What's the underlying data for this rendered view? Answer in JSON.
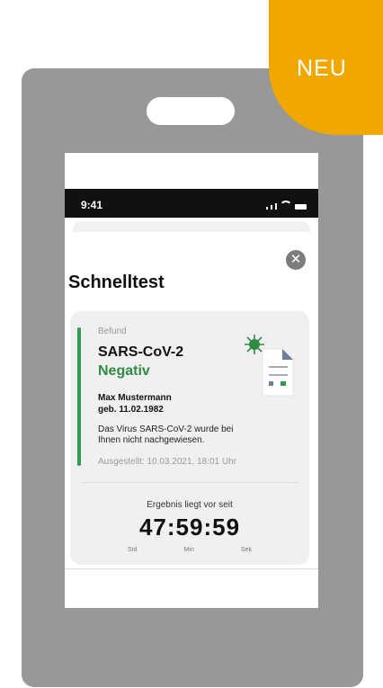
{
  "badge": {
    "label": "NEU",
    "color": "#f0a800"
  },
  "status_bar": {
    "time": "9:41"
  },
  "sheet": {
    "title": "Schnelltest"
  },
  "result": {
    "label": "Befund",
    "test_name": "SARS-CoV-2",
    "status": "Negativ",
    "person_name": "Max Mustermann",
    "birth": "geb. 11.02.1982",
    "message": "Das Virus SARS-CoV-2 wurde bei Ihnen nicht nachgewiesen.",
    "issued": "Ausgestellt: 10.03.2021, 18:01 Uhr",
    "since_label": "Ergebnis liegt vor seit",
    "timer": "47:59:59",
    "units": [
      "Std",
      "Min",
      "Sek"
    ]
  },
  "colors": {
    "accent_green": "#2f9b4e",
    "device_gray": "#989898"
  },
  "icons": [
    "close-icon",
    "virus-document-icon",
    "signal-icon",
    "wifi-icon",
    "battery-icon"
  ]
}
